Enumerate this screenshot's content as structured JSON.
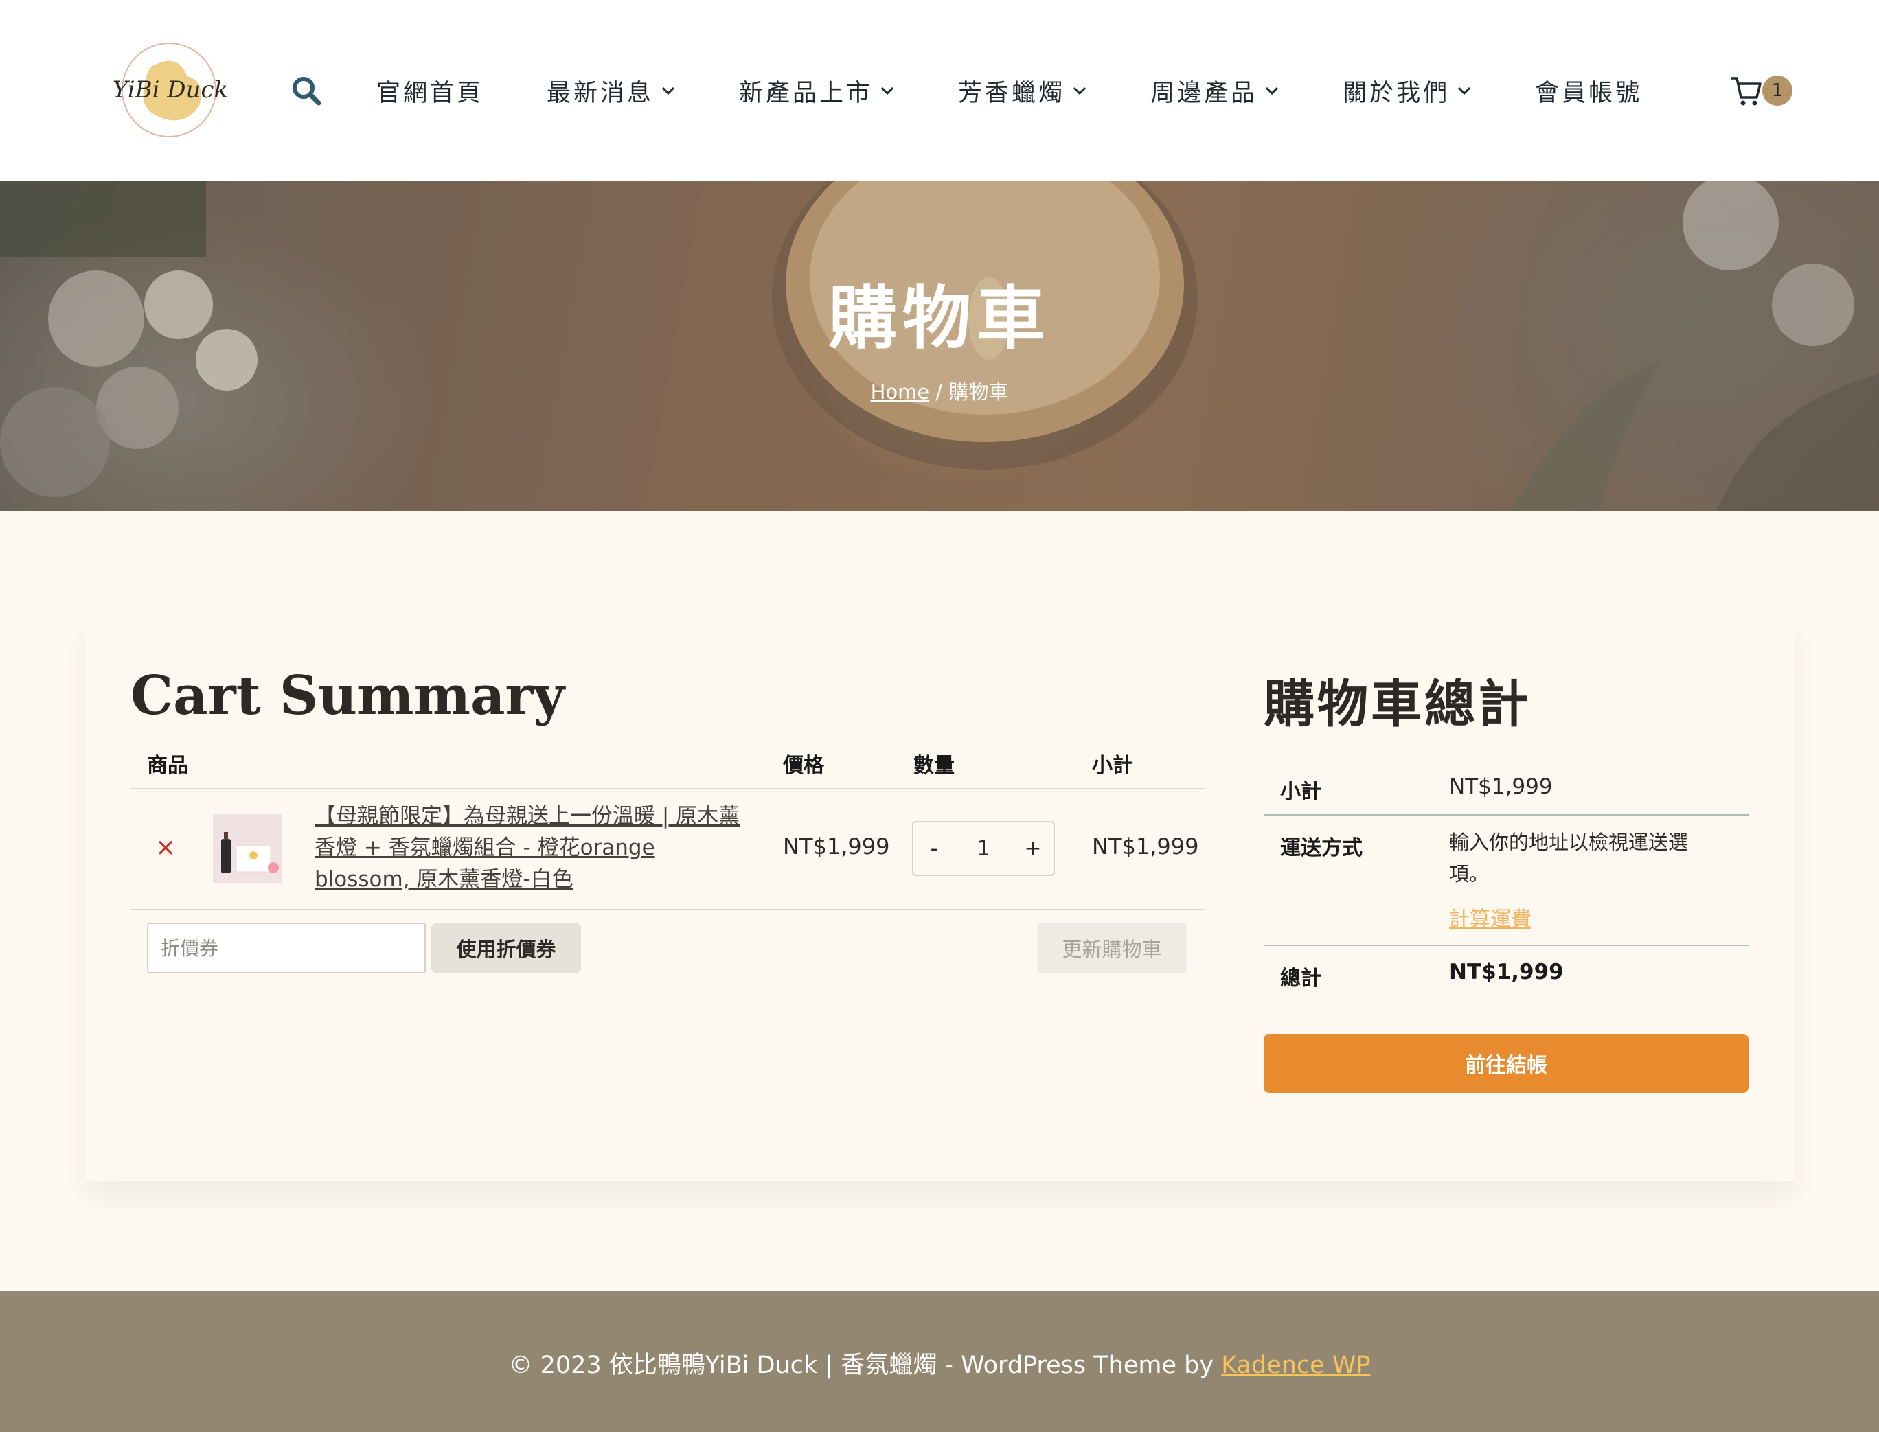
{
  "header": {
    "logo_text": "YiBi Duck",
    "nav": [
      {
        "label": "官網首頁",
        "dropdown": false
      },
      {
        "label": "最新消息",
        "dropdown": true
      },
      {
        "label": "新產品上市",
        "dropdown": true
      },
      {
        "label": "芳香蠟燭",
        "dropdown": true
      },
      {
        "label": "周邊產品",
        "dropdown": true
      },
      {
        "label": "關於我們",
        "dropdown": true
      },
      {
        "label": "會員帳號",
        "dropdown": false
      }
    ],
    "cart_count": "1"
  },
  "hero": {
    "title": "購物車",
    "breadcrumb": {
      "home": "Home",
      "separator": " / ",
      "current": "購物車"
    }
  },
  "cart": {
    "title": "Cart Summary",
    "columns": {
      "product": "商品",
      "price": "價格",
      "quantity": "數量",
      "subtotal": "小計"
    },
    "items": [
      {
        "remove": "×",
        "name": "【母親節限定】為母親送上一份溫暖 | 原木薰香燈 + 香氛蠟燭組合 - 橙花orange blossom, 原木薰香燈-白色",
        "price": "NT$1,999",
        "qty": "1",
        "qty_minus": "-",
        "qty_plus": "+",
        "subtotal": "NT$1,999"
      }
    ],
    "coupon_placeholder": "折價券",
    "apply_coupon": "使用折價券",
    "update_cart": "更新購物車"
  },
  "totals": {
    "title": "購物車總計",
    "subtotal_label": "小計",
    "subtotal_value": "NT$1,999",
    "shipping_label": "運送方式",
    "shipping_note": "輸入你的地址以檢視運送選項。",
    "calc_shipping": "計算運費",
    "total_label": "總計",
    "total_value": "NT$1,999",
    "checkout": "前往結帳"
  },
  "footer": {
    "text": "© 2023 依比鴨鴨YiBi Duck | 香氛蠟燭 - WordPress Theme by ",
    "link": "Kadence WP"
  },
  "colors": {
    "accent": "#e88b2e",
    "link": "#f0b55e",
    "footer_bg": "#948771",
    "remove": "#d0302a",
    "page_bg": "#fdf8f0"
  }
}
